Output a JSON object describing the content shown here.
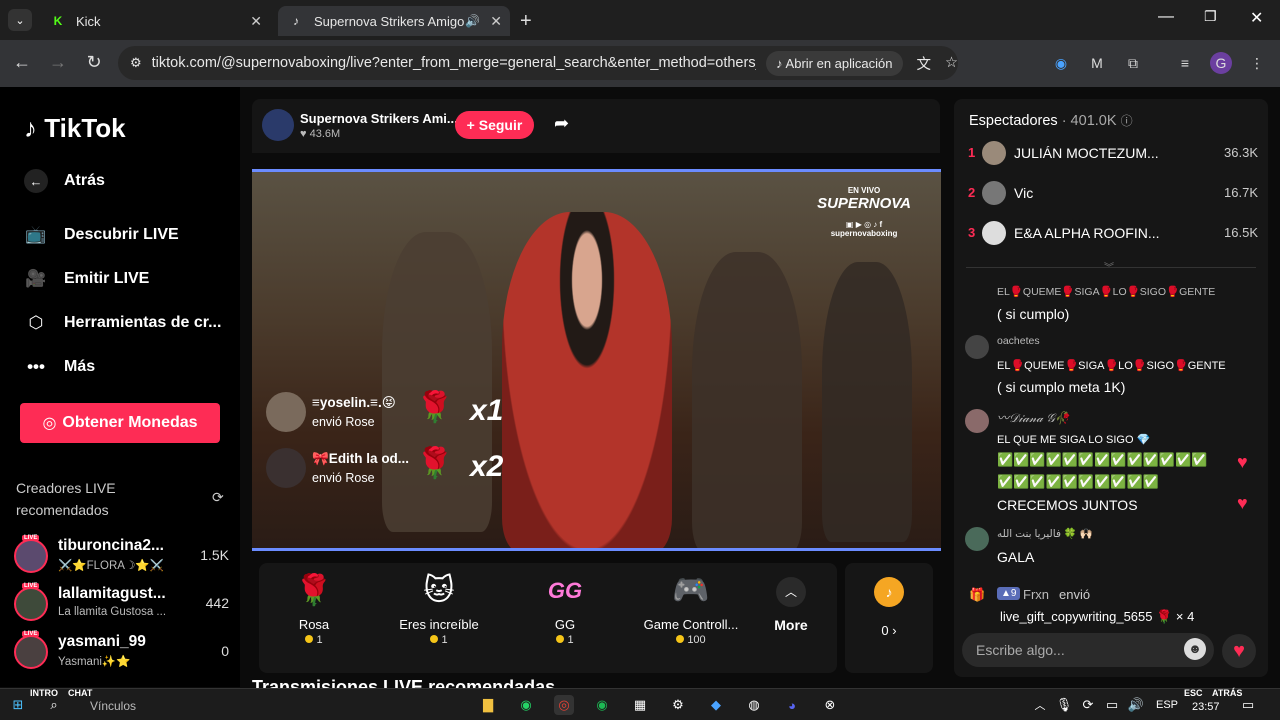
{
  "browser": {
    "tabs": [
      {
        "title": "Kick",
        "active": false
      },
      {
        "title": "Supernova Strikers Amigo (",
        "active": true
      }
    ],
    "url": "tiktok.com/@supernovaboxing/live?enter_from_merge=general_search&enter_method=others_photo...",
    "open_in_app": "Abrir en aplicación",
    "profile_initial": "G"
  },
  "sidebar": {
    "logo": "TikTok",
    "back": "Atrás",
    "items": [
      {
        "label": "Descubrir LIVE",
        "icon": "tv-icon"
      },
      {
        "label": "Emitir LIVE",
        "icon": "camera-icon"
      },
      {
        "label": "Herramientas de cr...",
        "icon": "tools-icon"
      },
      {
        "label": "Más",
        "icon": "more-icon"
      }
    ],
    "coins_button": "Obtener Monedas",
    "recommended_title": "Creadores LIVE recomendados",
    "live_badge": "LIVE",
    "creators": [
      {
        "name": "tiburoncina2...",
        "sub": "⚔️⭐️FLORA☽⭐️⚔️",
        "count": "1.5K"
      },
      {
        "name": "lallamitagust...",
        "sub": "La llamita Gustosa ...",
        "count": "442"
      },
      {
        "name": "yasmani_99",
        "sub": "Yasmani✨⭐️",
        "count": "0"
      }
    ]
  },
  "stream": {
    "host_name": "Supernova Strikers Ami...",
    "likes": "43.6M",
    "follow": "+ Seguir",
    "overlay_lines": [
      "EN VIVO",
      "SUPERNOVA",
      "supernovaboxing"
    ],
    "gift_notices": [
      {
        "user": "≡yoselin.≡.😝",
        "action": "envió Rose",
        "mult": "x1"
      },
      {
        "user": "🎀Edith la od...",
        "action": "envió Rose",
        "mult": "x2"
      }
    ],
    "gifts": [
      {
        "name": "Rosa",
        "price": "1",
        "icon": "🌹"
      },
      {
        "name": "Eres increíble",
        "price": "1",
        "icon": "🐱"
      },
      {
        "name": "GG",
        "price": "1",
        "icon": "GG"
      },
      {
        "name": "Game Controll...",
        "price": "100",
        "icon": "🎮"
      }
    ],
    "more": "More",
    "balance": "0 ›",
    "recommended_streams": "Transmisiones LIVE recomendadas"
  },
  "viewers": {
    "title": "Espectadores",
    "count": "· 401.0K",
    "top": [
      {
        "rank": "1",
        "name": "JULIÁN MOCTEZUM...",
        "count": "36.3K"
      },
      {
        "rank": "2",
        "name": "Vic",
        "count": "16.7K"
      },
      {
        "rank": "3",
        "name": "E&A ALPHA ROOFIN...",
        "count": "16.5K"
      }
    ]
  },
  "chat": {
    "messages": [
      {
        "user": "EL🥊QUEME🥊SIGA🥊LO🥊SIGO🥊GENTE",
        "lines": [
          "( si cumplo)"
        ]
      },
      {
        "user": "oachetes",
        "lines": [
          "EL🥊QUEME🥊SIGA🥊LO🥊SIGO🥊GENTE",
          "( si cumplo meta 1K)"
        ]
      },
      {
        "user": "〰𝒟𝒾𝒶𝓃𝒶 𝒢🥀",
        "lines": [
          "EL QUE ME SIGA LO SIGO 💎",
          "✅✅✅✅✅✅✅✅✅✅✅✅✅",
          "✅✅✅✅✅✅✅✅✅✅",
          "CRECEMOS JUNTOS"
        ]
      },
      {
        "user": "فاليريا بنت الله 🍀 🙌🏻",
        "lines": [
          "GALA"
        ]
      }
    ],
    "gift_event_level": "9",
    "gift_event_user": "Frxn",
    "gift_event_action": "envió",
    "gift_event_text": "live_gift_copywriting_5655 🌹 × 4",
    "input_placeholder": "Escribe algo..."
  },
  "taskbar": {
    "search_label": "Vínculos",
    "language": "ESP",
    "time": "23:57",
    "overlay_left": [
      "INTRO",
      "CHAT"
    ],
    "overlay_right": [
      "ESC",
      "ATRÁS"
    ]
  }
}
